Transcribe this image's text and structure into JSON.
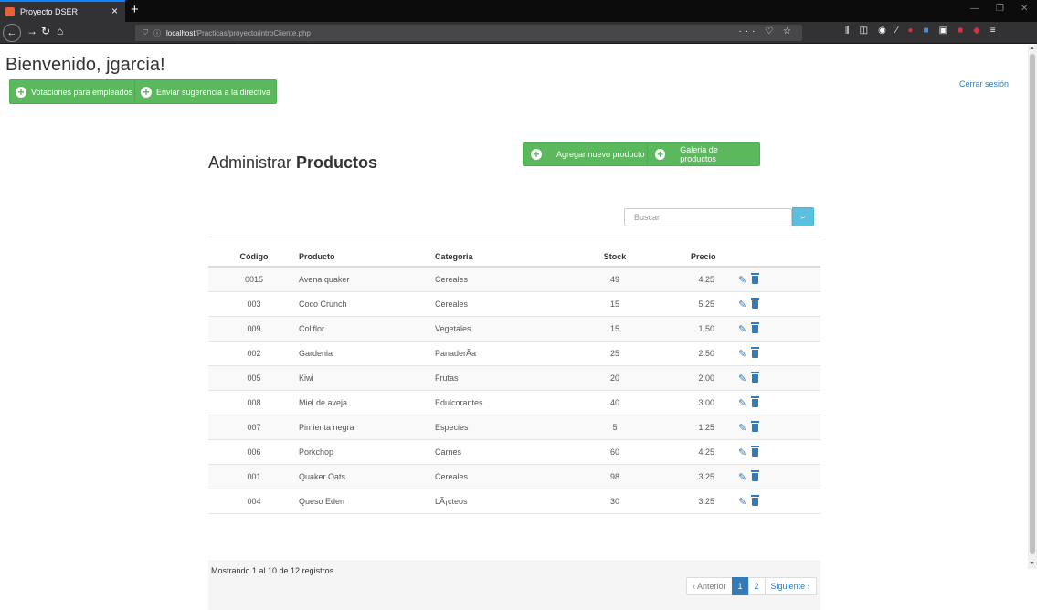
{
  "browser": {
    "tab_title": "Proyecto DSER",
    "url_host": "localhost",
    "url_path": "/Practicas/proyecto/introCliente.php"
  },
  "header": {
    "welcome": "Bienvenido, jgarcia!",
    "btn_votaciones": "Votaciones para empleados",
    "btn_sugerencia": "Enviar sugerencia a la directiva",
    "logout": "Cerrar sesión"
  },
  "panel": {
    "title_prefix": "Administrar ",
    "title_bold": "Productos",
    "btn_agregar": "Agregar nuevo producto",
    "btn_galeria": "Galeria de productos",
    "search_placeholder": "Buscar"
  },
  "table": {
    "headers": [
      "Código",
      "Producto",
      "Categoria",
      "Stock",
      "Precio"
    ],
    "rows": [
      {
        "code": "0015",
        "product": "Avena quaker",
        "category": "Cereales",
        "stock": "49",
        "price": "4.25"
      },
      {
        "code": "003",
        "product": "Coco Crunch",
        "category": "Cereales",
        "stock": "15",
        "price": "5.25"
      },
      {
        "code": "009",
        "product": "Coliflor",
        "category": "Vegetales",
        "stock": "15",
        "price": "1.50"
      },
      {
        "code": "002",
        "product": "Gardenia",
        "category": "PanaderÃa",
        "stock": "25",
        "price": "2.50"
      },
      {
        "code": "005",
        "product": "Kiwi",
        "category": "Frutas",
        "stock": "20",
        "price": "2.00"
      },
      {
        "code": "008",
        "product": "Miel de aveja",
        "category": "Edulcorantes",
        "stock": "40",
        "price": "3.00"
      },
      {
        "code": "007",
        "product": "Pimienta negra",
        "category": "Especies",
        "stock": "5",
        "price": "1.25"
      },
      {
        "code": "006",
        "product": "Porkchop",
        "category": "Carnes",
        "stock": "60",
        "price": "4.25"
      },
      {
        "code": "001",
        "product": "Quaker Oats",
        "category": "Cereales",
        "stock": "98",
        "price": "3.25"
      },
      {
        "code": "004",
        "product": "Queso Eden",
        "category": "LÃ¡cteos",
        "stock": "30",
        "price": "3.25"
      }
    ]
  },
  "footer": {
    "showing": "Mostrando 1 al 10 de 12 registros",
    "prev": "‹ Anterior",
    "pages": [
      "1",
      "2"
    ],
    "next": "Siguiente ›"
  },
  "colors": {
    "green": "#5cb85c",
    "info": "#5bc0de",
    "primary": "#337ab7"
  },
  "icons": [
    "plus-circle-icon",
    "search-icon",
    "pencil-icon",
    "trash-icon"
  ]
}
